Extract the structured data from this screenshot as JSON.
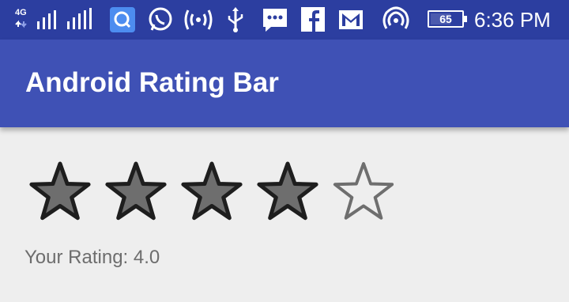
{
  "status_bar": {
    "network": "4G",
    "battery": "65",
    "battery_fraction": 0.65,
    "time": "6:36 PM",
    "icons": [
      "signal-icon",
      "signal-icon",
      "search-app-icon",
      "whatsapp-icon",
      "hotspot-icon",
      "usb-icon",
      "messages-icon",
      "facebook-icon",
      "gmail-icon",
      "wifi-icon",
      "battery-icon"
    ]
  },
  "app_bar": {
    "title": "Android Rating Bar",
    "color": "#3f51b5"
  },
  "rating": {
    "value": 4,
    "max": 5,
    "label_prefix": "Your Rating: ",
    "label": "Your Rating: 4.0",
    "filled_color": "#6e6e6e",
    "stroke_color": "#1e1e1e",
    "empty_stroke_color": "#6e6e6e"
  }
}
